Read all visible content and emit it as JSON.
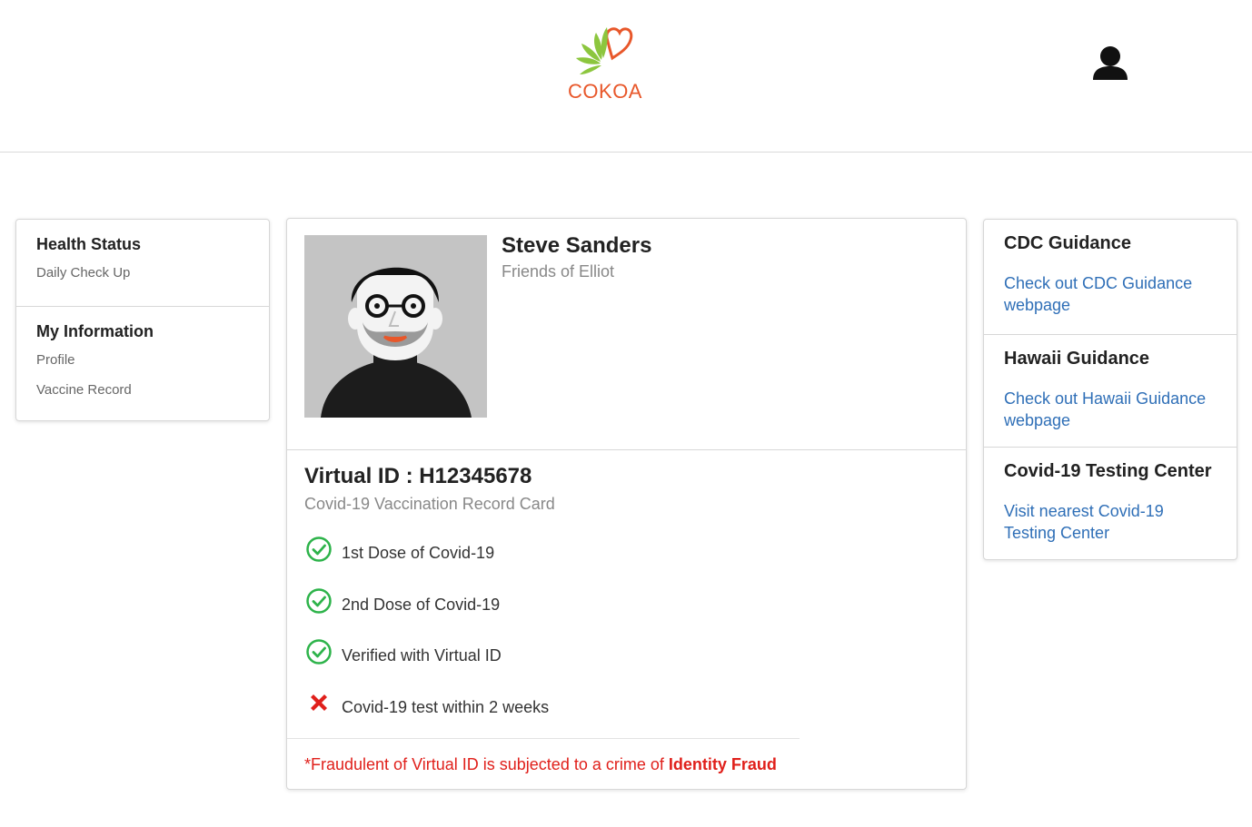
{
  "header": {
    "logo_text": "COKOA",
    "user_icon": "user-icon"
  },
  "sidebar": {
    "sections": [
      {
        "title": "Health Status",
        "items": [
          "Daily Check Up"
        ]
      },
      {
        "title": "My Information",
        "items": [
          "Profile",
          "Vaccine Record"
        ]
      }
    ]
  },
  "profile": {
    "name": "Steve Sanders",
    "organization": "Friends of Elliot"
  },
  "record": {
    "virtual_id": "Virtual ID : H12345678",
    "subtitle": "Covid-19 Vaccination Record Card",
    "items": [
      {
        "label": "1st Dose of Covid-19",
        "status": "check-circle-icon"
      },
      {
        "label": "2nd Dose of Covid-19",
        "status": "check-circle-icon"
      },
      {
        "label": "Verified with Virtual ID",
        "status": "check-circle-icon"
      },
      {
        "label": "Covid-19 test within 2 weeks",
        "status": "cross-icon"
      }
    ],
    "fraud_notice": "*Fraudulent of Virtual ID is subjected to a crime of ",
    "fraud_emphasis": "Identity Fraud"
  },
  "guidance": {
    "sections": [
      {
        "title": "CDC Guidance",
        "link": "Check out CDC Guidance webpage"
      },
      {
        "title": "Hawaii Guidance",
        "link": "Check out Hawaii Guidance webpage"
      },
      {
        "title": "Covid-19 Testing Center",
        "link": "Visit nearest Covid-19 Testing Center"
      }
    ]
  },
  "colors": {
    "brand": "#e8572a",
    "leaf": "#8cc63e",
    "link": "#2f6fb7",
    "success": "#2db34a",
    "danger": "#e0201b"
  }
}
